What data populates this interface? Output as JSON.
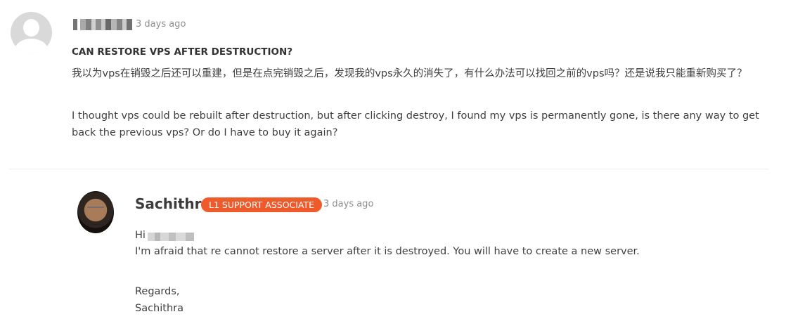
{
  "question": {
    "time": "3 days ago",
    "title": "CAN RESTORE VPS AFTER DESTRUCTION?",
    "body_cn": "我以为vps在销毁之后还可以重建，但是在点完销毁之后，发现我的vps永久的消失了，有什么办法可以找回之前的vps吗？还是说我只能重新购买了？",
    "body_en": "I thought vps could be rebuilt after destruction, but after clicking destroy, I found my vps is permanently gone, is there any way to get back the previous vps? Or do I have to buy it again?"
  },
  "reply": {
    "author": "Sachithra",
    "badge": "L1 SUPPORT ASSOCIATE",
    "time": "3 days ago",
    "greeting": "Hi",
    "message": "I'm afraid that re cannot restore a server after it is destroyed. You will have to create a new server.",
    "regards": "Regards,",
    "signature": "Sachithra"
  },
  "colors": {
    "badge_bg": "#ef5a2b",
    "muted_text": "#8e8e8e",
    "text": "#3f3f3f"
  }
}
